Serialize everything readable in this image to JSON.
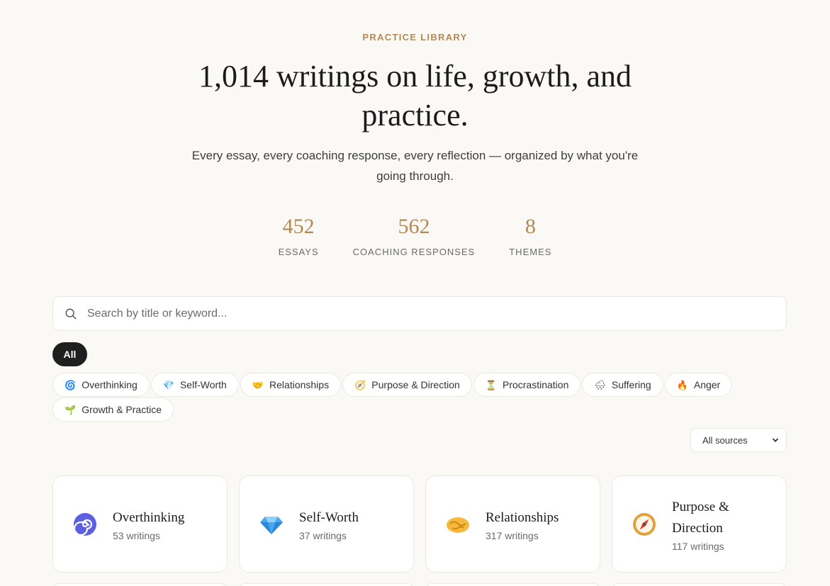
{
  "hero": {
    "eyebrow": "PRACTICE LIBRARY",
    "title_line1": "1,014 writings on life, growth, and",
    "title_line2": "practice.",
    "subtitle": "Every essay, every coaching response, every reflection — organized by what you're going through."
  },
  "stats": [
    {
      "value": "452",
      "label": "ESSAYS"
    },
    {
      "value": "562",
      "label": "COACHING RESPONSES"
    },
    {
      "value": "8",
      "label": "THEMES"
    }
  ],
  "search": {
    "placeholder": "Search by title or keyword..."
  },
  "filters": {
    "all_label": "All",
    "chips": [
      {
        "icon": "spiral-icon",
        "glyph": "🌀",
        "label": "Overthinking"
      },
      {
        "icon": "gem-icon",
        "glyph": "💎",
        "label": "Self-Worth"
      },
      {
        "icon": "handshake-icon",
        "glyph": "🤝",
        "label": "Relationships"
      },
      {
        "icon": "compass-icon",
        "glyph": "🧭",
        "label": "Purpose & Direction"
      },
      {
        "icon": "hourglass-icon",
        "glyph": "⏳",
        "label": "Procrastination"
      },
      {
        "icon": "rain-cloud-icon",
        "glyph": "🌧",
        "label": "Suffering"
      },
      {
        "icon": "fire-icon",
        "glyph": "🔥",
        "label": "Anger"
      },
      {
        "icon": "seedling-icon",
        "glyph": "🌱",
        "label": "Growth & Practice"
      }
    ]
  },
  "sources_select": {
    "value": "All sources"
  },
  "cards": [
    {
      "icon": "spiral-icon",
      "title": "Overthinking",
      "count": "53 writings"
    },
    {
      "icon": "gem-icon",
      "title": "Self-Worth",
      "count": "37 writings"
    },
    {
      "icon": "handshake-icon",
      "title": "Relationships",
      "count": "317 writings"
    },
    {
      "icon": "compass-icon",
      "title": "Purpose & Direction",
      "count": "117 writings"
    }
  ],
  "colors": {
    "accent": "#b08a55",
    "background": "#faf9f6",
    "chip_active": "#1f1f1f"
  }
}
